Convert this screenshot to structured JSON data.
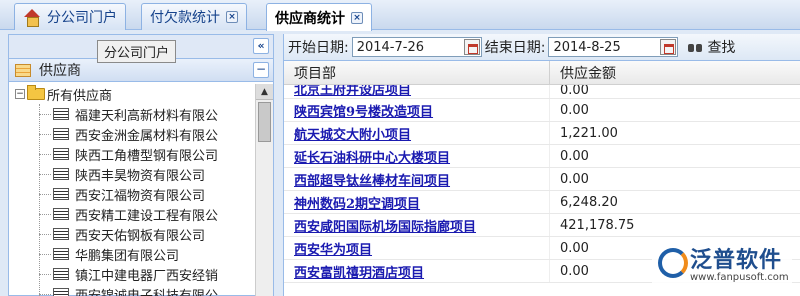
{
  "tabs": [
    {
      "label": "分公司门户",
      "active": false,
      "closable": false
    },
    {
      "label": "付欠款统计",
      "active": false,
      "closable": true
    },
    {
      "label": "供应商统计",
      "active": true,
      "closable": true
    }
  ],
  "left_panel": {
    "tooltip": "分公司门户",
    "collapse_label": "«",
    "header_title": "供应商",
    "header_button": "−",
    "tree": {
      "root_expander": "−",
      "root_label": "所有供应商",
      "items": [
        "福建天利高新材料有限公",
        "西安金洲金属材料有限公",
        "陕西工角槽型钢有限公司",
        "陕西丰昊物资有限公司",
        "西安江福物资有限公司",
        "西安精工建设工程有限公",
        "西安天佑钢板有限公司",
        "华鹏集团有限公司",
        "镇江中建电器厂西安经销",
        "西安锦诚电子科技有限公"
      ]
    }
  },
  "filter": {
    "start_label": "开始日期:",
    "start_value": "2014-7-26",
    "end_label": "结束日期:",
    "end_value": "2014-8-25",
    "search_label": "查找"
  },
  "table": {
    "columns": [
      "项目部",
      "供应金额"
    ],
    "rows": [
      {
        "project": "北京王府井设店项目",
        "amount": "0.00"
      },
      {
        "project": "陕西宾馆9号楼改造项目",
        "amount": "0.00"
      },
      {
        "project": "航天城交大附小项目",
        "amount": "1,221.00"
      },
      {
        "project": "延长石油科研中心大楼项目",
        "amount": "0.00"
      },
      {
        "project": "西部超导钛丝棒材车间项目",
        "amount": "0.00"
      },
      {
        "project": "神州数码2期空调项目",
        "amount": "6,248.20"
      },
      {
        "project": "西安咸阳国际机场国际指廊项目",
        "amount": "421,178.75"
      },
      {
        "project": "西安华为项目",
        "amount": "0.00"
      },
      {
        "project": "西安富凯禧玥酒店项目",
        "amount": "0.00"
      }
    ]
  },
  "watermark": {
    "brand": "泛普软件",
    "url": "www.fanpusoft.com"
  },
  "colors": {
    "accent": "#99bbe8",
    "link": "#1a1ab0"
  }
}
